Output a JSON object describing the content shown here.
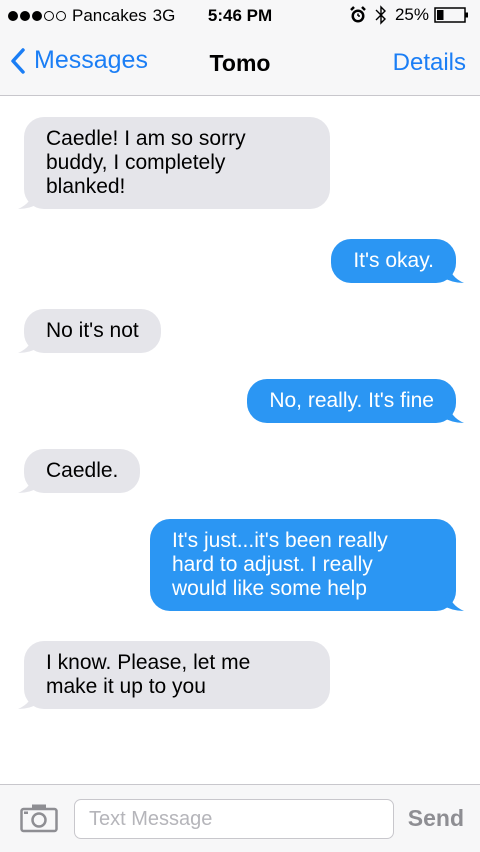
{
  "status_bar": {
    "signal_bars_filled": 3,
    "signal_bars_total": 5,
    "carrier": "Pancakes",
    "network": "3G",
    "time": "5:46 PM",
    "battery_percent_label": "25%",
    "battery_level": 0.25
  },
  "nav": {
    "back_label": "Messages",
    "title": "Tomo",
    "details_label": "Details"
  },
  "messages": [
    {
      "from": "them",
      "lines": [
        "Caedle! I am so sorry",
        "buddy, I completely",
        "blanked!"
      ]
    },
    {
      "from": "me",
      "lines": [
        "It's okay."
      ]
    },
    {
      "from": "them",
      "lines": [
        "No it's not"
      ]
    },
    {
      "from": "me",
      "lines": [
        "No, really. It's fine"
      ]
    },
    {
      "from": "them",
      "lines": [
        "Caedle."
      ]
    },
    {
      "from": "me",
      "lines": [
        "It's just...it's been really",
        "hard to adjust. I really",
        "would like some help"
      ]
    },
    {
      "from": "them",
      "lines": [
        "I know. Please, let me",
        "make it up to you"
      ]
    }
  ],
  "input_bar": {
    "placeholder": "Text Message",
    "value": "",
    "send_label": "Send"
  },
  "colors": {
    "accent_blue": "#1b7ef5",
    "outgoing_bubble": "#2b96f3",
    "incoming_bubble": "#e5e5ea",
    "send_disabled": "#8e8e93"
  },
  "icons": {
    "alarm": "alarm-clock-icon",
    "bluetooth": "bluetooth-icon",
    "battery": "battery-icon",
    "back": "chevron-left-icon",
    "camera": "camera-icon"
  }
}
